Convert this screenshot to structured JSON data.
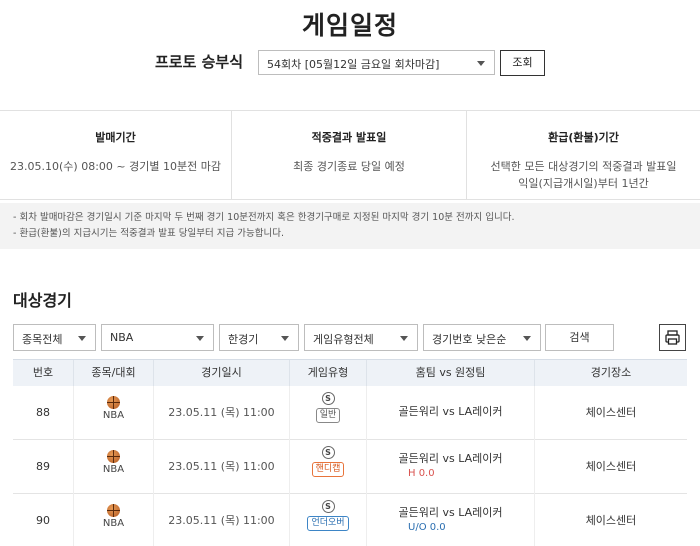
{
  "page": {
    "title": "게임일정"
  },
  "round": {
    "label": "프로토 승부식",
    "selected": "54회차 [05월12일 금요일 회차마감]",
    "lookup_button": "조회"
  },
  "info": [
    {
      "title": "발매기간",
      "body": [
        "23.05.10(수) 08:00 ~ 경기별 10분전 마감"
      ]
    },
    {
      "title": "적중결과 발표일",
      "body": [
        "최종 경기종료 당일 예정"
      ]
    },
    {
      "title": "환급(환불)기간",
      "body": [
        "선택한 모든 대상경기의 적중결과 발표일",
        "익일(지급개시일)부터 1년간"
      ]
    }
  ],
  "notes": [
    "- 회차 발매마감은 경기일시 기준 마지막 두 번째 경기 10분전까지 혹은 한경기구매로 지정된 마지막 경기 10분 전까지 입니다.",
    "- 환급(환불)의 지급시기는 적중결과 발표 당일부터 지급 가능합니다."
  ],
  "section": {
    "title": "대상경기"
  },
  "filters": {
    "sport": "종목전체",
    "league": "NBA",
    "game_scope": "한경기",
    "game_type": "게임유형전체",
    "sort": "경기번호 낮은순",
    "search_button": "검색"
  },
  "icons": {
    "print": "printer-icon",
    "sport": "basketball-icon",
    "game": "s-circle-icon"
  },
  "table": {
    "headers": [
      "번호",
      "종목/대회",
      "경기일시",
      "게임유형",
      "홈팀 vs 원정팀",
      "경기장소"
    ],
    "rows": [
      {
        "no": "88",
        "league": "NBA",
        "datetime": "23.05.11 (목) 11:00",
        "game_type": "일반",
        "matchup": "골든워리 vs LA레이커",
        "sub": "",
        "venue": "체이스센터"
      },
      {
        "no": "89",
        "league": "NBA",
        "datetime": "23.05.11 (목) 11:00",
        "game_type": "핸디캡",
        "matchup": "골든워리 vs LA레이커",
        "sub": "H 0.0",
        "venue": "체이스센터"
      },
      {
        "no": "90",
        "league": "NBA",
        "datetime": "23.05.11 (목) 11:00",
        "game_type": "언더오버",
        "matchup": "골든워리 vs LA레이커",
        "sub": "U/O 0.0",
        "venue": "체이스센터"
      }
    ]
  },
  "colors": {
    "handicap": "#d85a1f",
    "underover": "#2a6eb0",
    "header_bg": "#eef2f7",
    "notes_bg": "#f3f3f3"
  }
}
